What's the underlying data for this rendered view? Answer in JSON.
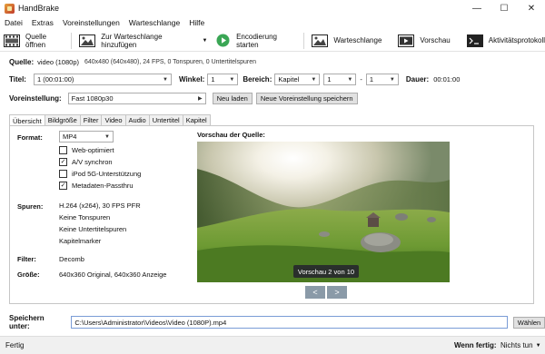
{
  "window": {
    "title": "HandBrake"
  },
  "menu": [
    "Datei",
    "Extras",
    "Voreinstellungen",
    "Warteschlange",
    "Hilfe"
  ],
  "toolbar": {
    "open_source": "Quelle öffnen",
    "add_queue": "Zur Warteschlange hinzufügen",
    "start": "Encodierung starten",
    "queue": "Warteschlange",
    "preview": "Vorschau",
    "activity": "Aktivitätsprotokoll"
  },
  "source": {
    "label": "Quelle:",
    "name": "video (1080p)",
    "info": "640x480 (640x480), 24 FPS, 0 Tonspuren, 0 Untertitelspuren"
  },
  "title_row": {
    "title_label": "Titel:",
    "title_value": "1 (00:01:00)",
    "angle_label": "Winkel:",
    "angle_value": "1",
    "range_label": "Bereich:",
    "range_type": "Kapitel",
    "range_from": "1",
    "range_dash": "-",
    "range_to": "1",
    "duration_label": "Dauer:",
    "duration_value": "00:01:00"
  },
  "preset": {
    "label": "Voreinstellung:",
    "value": "Fast 1080p30",
    "reload": "Neu laden",
    "save_new": "Neue Voreinstellung speichern"
  },
  "tabs": [
    "Übersicht",
    "Bildgröße",
    "Filter",
    "Video",
    "Audio",
    "Untertitel",
    "Kapitel"
  ],
  "summary": {
    "format_label": "Format:",
    "format_value": "MP4",
    "checkboxes": [
      {
        "label": "Web-optimiert",
        "checked": false
      },
      {
        "label": "A/V synchron",
        "checked": true
      },
      {
        "label": "iPod 5G-Unterstützung",
        "checked": false
      },
      {
        "label": "Metadaten-Passthru",
        "checked": true
      }
    ],
    "tracks_label": "Spuren:",
    "tracks": [
      "H.264 (x264), 30 FPS PFR",
      "Keine Tonspuren",
      "Keine Untertitelspuren",
      "Kapitelmarker"
    ],
    "filter_label": "Filter:",
    "filter_value": "Decomb",
    "size_label": "Größe:",
    "size_value": "640x360 Original, 640x360 Anzeige",
    "preview_label": "Vorschau der Quelle:",
    "preview_caption": "Vorschau 2 von 10",
    "prev": "<",
    "next": ">"
  },
  "save": {
    "label": "Speichern unter:",
    "path": "C:\\Users\\Administrator\\Videos\\Video (1080P).mp4",
    "browse": "Wählen"
  },
  "status": {
    "text": "Fertig",
    "when_done_label": "Wenn fertig:",
    "when_done_value": "Nichts tun"
  },
  "colors": {
    "accent": "#7a9cd6",
    "start_green": "#3aa655"
  }
}
